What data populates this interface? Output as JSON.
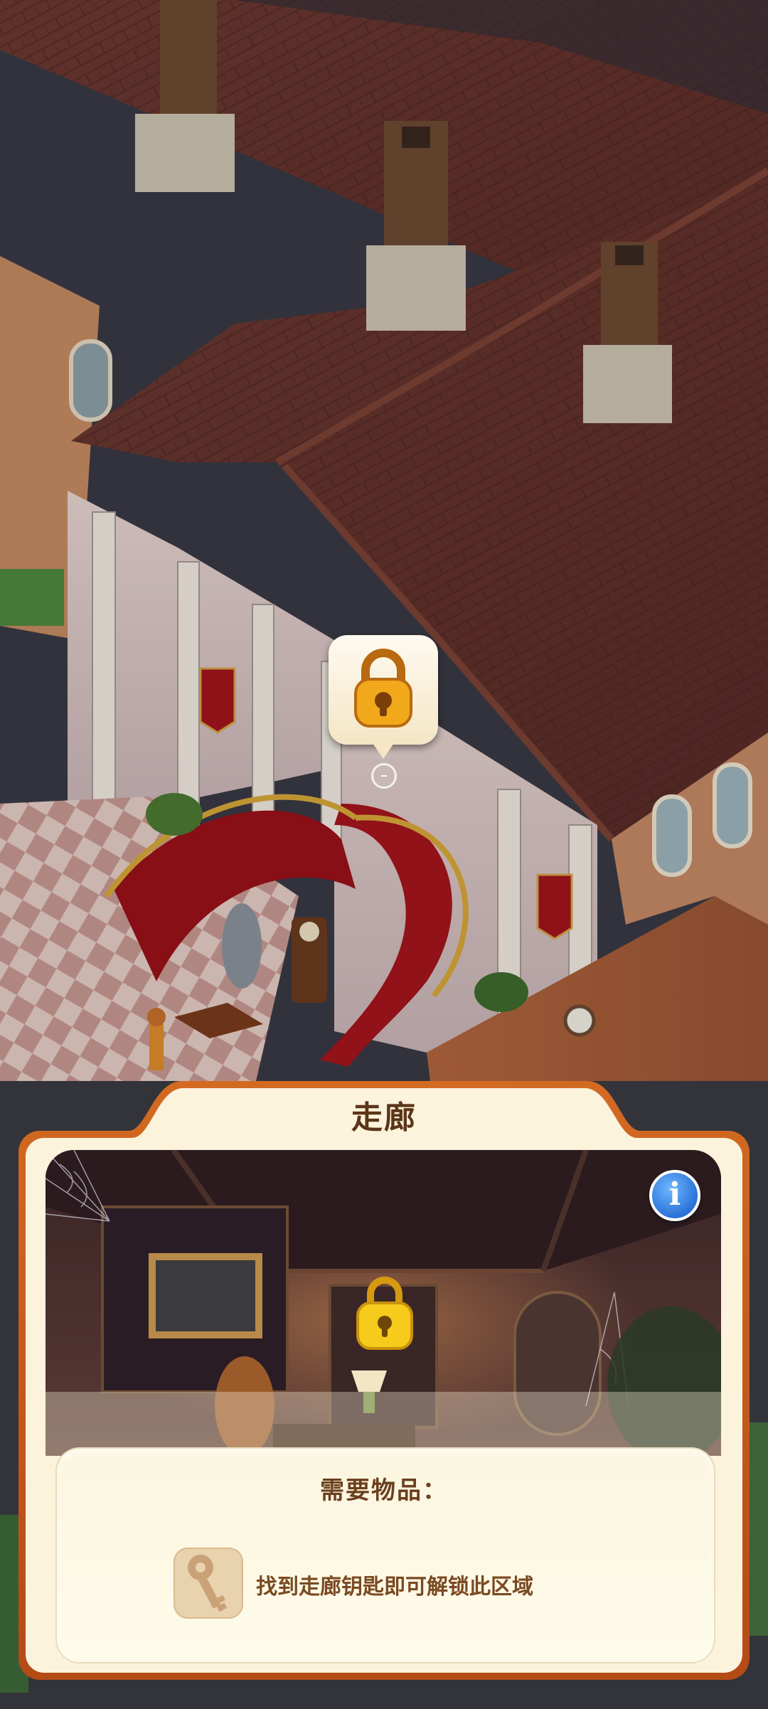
{
  "scene": {
    "description_labels": []
  },
  "lock_marker": {
    "icon": "padlock-icon"
  },
  "panel": {
    "title": "走廊",
    "info_button_label": "i",
    "room_lock_icon": "padlock-icon",
    "requirements": {
      "heading": "需要物品：",
      "item_icon": "key-icon",
      "text_prefix": "找到",
      "text_highlight": "走廊钥匙",
      "text_suffix": "即可解锁此区域"
    }
  },
  "colors": {
    "panel_border": "#c0581e",
    "panel_fill": "#fbf3dc",
    "title_text": "#5c3418",
    "info_blue": "#2a72d8",
    "lock_gold": "#f2b21a"
  }
}
